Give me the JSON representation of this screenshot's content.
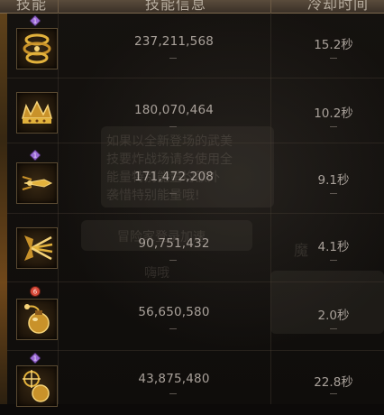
{
  "header": {
    "col_skill": "技能",
    "col_info": "技能信息",
    "col_cooldown": "冷却时间"
  },
  "rows": [
    {
      "icon": "golden-swirl-skill-icon",
      "gem": "purple-diamond",
      "value": "237,211,568",
      "cooldown": "15.2秒"
    },
    {
      "icon": "golden-crown-flame-skill-icon",
      "gem": "none",
      "value": "180,070,464",
      "cooldown": "10.2秒"
    },
    {
      "icon": "golden-dart-strike-skill-icon",
      "gem": "purple-diamond",
      "value": "171,472,208",
      "cooldown": "9.1秒"
    },
    {
      "icon": "golden-spread-burst-skill-icon",
      "gem": "none",
      "value": "90,751,432",
      "cooldown": "4.1秒"
    },
    {
      "icon": "golden-bomb-skill-icon",
      "gem": "red-circle",
      "value": "56,650,580",
      "cooldown": "2.0秒"
    },
    {
      "icon": "golden-target-bomb-skill-icon",
      "gem": "purple-diamond",
      "value": "43,875,480",
      "cooldown": "22.8秒"
    }
  ],
  "background_text": {
    "line1": "如果以全新登场的武美",
    "line2": "技要炸战场请务使用全",
    "line3": "能量特别能量均额外",
    "line4": "袭惜特别能量哦!",
    "line5": "冒险家登录加速",
    "line6": "魔",
    "line7": "嗨哦"
  },
  "colors": {
    "header_bg": "#4a3e32",
    "text": "#a9a19a",
    "icon_gold": "#e3b23c",
    "gem_purple": "#9b6bd6",
    "gem_red": "#d84a3a"
  }
}
